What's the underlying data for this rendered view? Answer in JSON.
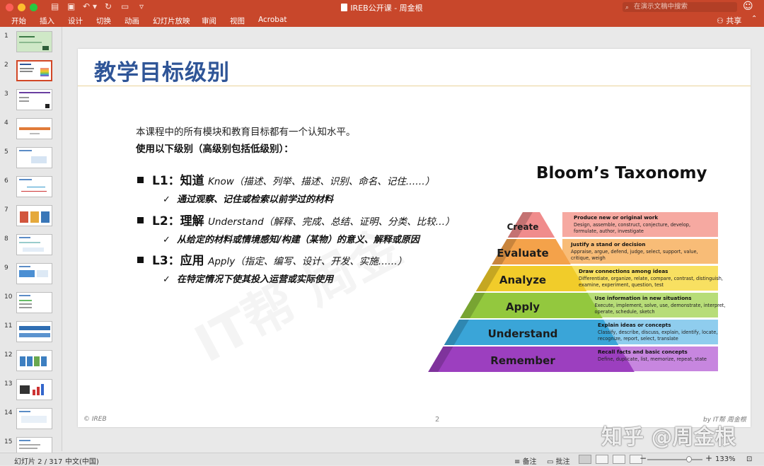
{
  "window": {
    "title": "IREB公开课 - 周金根",
    "search_placeholder": "在演示文稿中搜索"
  },
  "ribbon": {
    "tabs": [
      "开始",
      "插入",
      "设计",
      "切换",
      "动画",
      "幻灯片放映",
      "审阅",
      "视图",
      "Acrobat"
    ],
    "share_label": "共享"
  },
  "thumbnails": {
    "numbers": [
      "1",
      "2",
      "3",
      "4",
      "5",
      "6",
      "7",
      "8",
      "9",
      "10",
      "11",
      "12",
      "13",
      "14",
      "15"
    ],
    "selected": 2
  },
  "slide": {
    "title": "教学目标级别",
    "intro_line": "本课程中的所有模块和教育目标都有一个认知水平。",
    "intro_bold": "使用以下级别（高级别包括低级别）：",
    "levels": [
      {
        "name": "L1：知道",
        "verbs": "Know（描述、列举、描述、识别、命名、记住……）",
        "detail": "通过观察、记住或检索以前学过的材料"
      },
      {
        "name": "L2：理解",
        "verbs": "Understand（解释、完成、总结、证明、分类、比较…）",
        "detail": "从给定的材料或情境感知/构建（某物）的意义、解释或原因"
      },
      {
        "name": "L3：应用",
        "verbs": "Apply（指定、编写、设计、开发、实施……）",
        "detail": "在特定情况下使其投入运营或实际使用"
      }
    ],
    "bloom": {
      "title": "Bloom’s Taxonomy",
      "tiers": [
        {
          "label": "Create",
          "heading": "Produce new or original work",
          "desc1": "Design, assemble, construct, conjecture, develop,",
          "desc2": "formulate, author, investigate",
          "color": "#f08c8c",
          "band": "#f6a9a1"
        },
        {
          "label": "Evaluate",
          "heading": "Justify a stand or decision",
          "desc1": "Appraise, argue, defend, judge, select, support,  value,",
          "desc2": "critique,  weigh",
          "color": "#f4a24a",
          "band": "#f8bc77"
        },
        {
          "label": "Analyze",
          "heading": "Draw connections among ideas",
          "desc1": "Differentiate, organize, relate, compare, contrast, distinguish,",
          "desc2": "examine, experiment, question, test",
          "color": "#f1cc2a",
          "band": "#f8e061"
        },
        {
          "label": "Apply",
          "heading": "Use information in new situations",
          "desc1": "Execute, implement, solve, use, demonstrate, interpret,",
          "desc2": "operate, schedule, sketch",
          "color": "#93c83e",
          "band": "#b7dd78"
        },
        {
          "label": "Understand",
          "heading": "Explain ideas or concepts",
          "desc1": "Classify, describe, discuss, explain, identify, locate,",
          "desc2": "recognize, report, select, translate",
          "color": "#3aa5d8",
          "band": "#8fcdee"
        },
        {
          "label": "Remember",
          "heading": "Recall facts and basic concepts",
          "desc1": "Define, duplicate, list, memorize, repeat, state",
          "desc2": "",
          "color": "#9c3fbf",
          "band": "#c786df"
        }
      ]
    },
    "footer_left": "© IREB",
    "page_number": "2",
    "footer_right": "by IT帮 周金根",
    "watermark": "IT帮  周金"
  },
  "overlay_watermark": "知乎 @周金根",
  "statusbar": {
    "slide_info": "幻灯片 2 / 317",
    "language": "中文(中国)",
    "notes_label": "备注",
    "comments_label": "批注",
    "zoom": "133%"
  }
}
